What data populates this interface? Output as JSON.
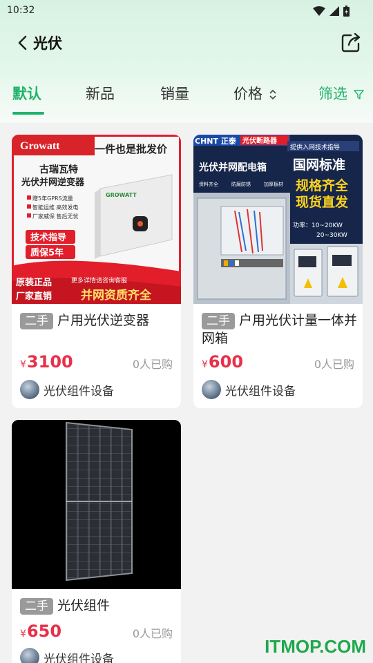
{
  "status_bar": {
    "time": "10:32"
  },
  "header": {
    "title": "光伏"
  },
  "tabs": [
    {
      "label": "默认"
    },
    {
      "label": "新品"
    },
    {
      "label": "销量"
    },
    {
      "label": "价格"
    },
    {
      "label": "筛选"
    }
  ],
  "products": [
    {
      "badge": "二手",
      "name": "户用光伏逆变器",
      "currency": "¥",
      "price": "3100",
      "sold": "0人已购",
      "shop": "光伏组件设备",
      "image_text": {
        "brand": "Growatt",
        "banner": "一件也是批发价",
        "headline1": "古瑞瓦特",
        "headline2": "光伏并网逆变器",
        "features": [
          "赠5年GPRS流量",
          "智能运维 高效发电",
          "厂家威保 售后无忧"
        ],
        "device_brand": "GROWATT",
        "tag1": "技术指导",
        "tag2": "质保5年",
        "footer1": "原装正品",
        "footer2": "厂家直销",
        "footer3": "更多详情请咨询客服",
        "footer4": "并网资质齐全"
      }
    },
    {
      "badge": "二手",
      "name": "户用光伏计量一体并网箱",
      "currency": "¥",
      "price": "600",
      "sold": "0人已购",
      "shop": "光伏组件设备",
      "image_text": {
        "brand": "CHNT 正泰",
        "banner": "光伏断路器",
        "subbanner": "提供入网技术指导",
        "headline": "光伏并网配电箱",
        "features": [
          "资料齐全",
          "防腐防锈",
          "加厚板材"
        ],
        "big1": "国网标准",
        "big2": "规格齐全",
        "big3": "现货直发",
        "power1": "功率：10~20KW",
        "power2": "20~30KW"
      }
    },
    {
      "badge": "二手",
      "name": "光伏组件",
      "currency": "¥",
      "price": "650",
      "sold": "0人已购",
      "shop": "光伏组件设备"
    }
  ],
  "watermark": "ITMOP.COM",
  "colors": {
    "accent": "#21b36b",
    "price": "#e8304a"
  }
}
